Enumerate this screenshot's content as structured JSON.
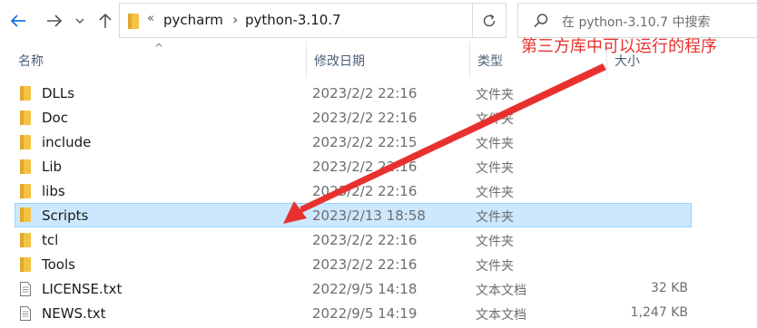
{
  "address_bar": {
    "overflow_glyph": "«",
    "crumbs": [
      "pycharm",
      "python-3.10.7"
    ],
    "search_placeholder": "在 python-3.10.7 中搜索"
  },
  "columns": {
    "name": "名称",
    "date": "修改日期",
    "type": "类型",
    "size": "大小"
  },
  "annotation": {
    "text": "第三方库中可以运行的程序",
    "color": "#e8312f"
  },
  "files": [
    {
      "name": "DLLs",
      "date": "2023/2/2 22:16",
      "type": "文件夹",
      "size": "",
      "icon": "folder-icon"
    },
    {
      "name": "Doc",
      "date": "2023/2/2 22:16",
      "type": "文件夹",
      "size": "",
      "icon": "folder-icon"
    },
    {
      "name": "include",
      "date": "2023/2/2 22:15",
      "type": "文件夹",
      "size": "",
      "icon": "folder-icon"
    },
    {
      "name": "Lib",
      "date": "2023/2/2 22:16",
      "type": "文件夹",
      "size": "",
      "icon": "folder-icon"
    },
    {
      "name": "libs",
      "date": "2023/2/2 22:16",
      "type": "文件夹",
      "size": "",
      "icon": "folder-icon"
    },
    {
      "name": "Scripts",
      "date": "2023/2/13 18:58",
      "type": "文件夹",
      "size": "",
      "icon": "folder-icon",
      "selected": true
    },
    {
      "name": "tcl",
      "date": "2023/2/2 22:16",
      "type": "文件夹",
      "size": "",
      "icon": "folder-icon"
    },
    {
      "name": "Tools",
      "date": "2023/2/2 22:16",
      "type": "文件夹",
      "size": "",
      "icon": "folder-icon"
    },
    {
      "name": "LICENSE.txt",
      "date": "2022/9/5 14:18",
      "type": "文本文档",
      "size": "32 KB",
      "icon": "text-file-icon"
    },
    {
      "name": "NEWS.txt",
      "date": "2022/9/5 14:19",
      "type": "文本文档",
      "size": "1,247 KB",
      "icon": "text-file-icon"
    }
  ],
  "colors": {
    "selection_bg": "#cce8ff",
    "selection_border": "#99d1ff",
    "folder": "#f4c343",
    "back_arrow": "#1a73e8"
  }
}
